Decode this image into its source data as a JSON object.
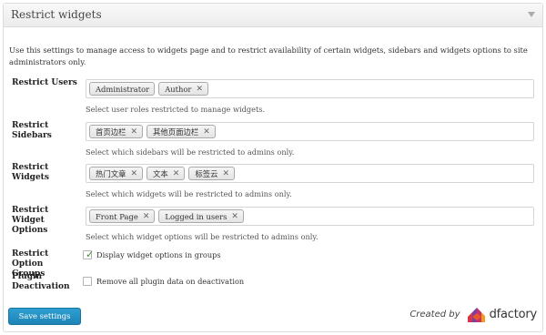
{
  "panel": {
    "title": "Restrict widgets"
  },
  "description": "Use this settings to manage access to widgets page and to restrict availability of certain widgets, sidebars and widgets options to site administrators only.",
  "rows": [
    {
      "label": "Restrict Users",
      "tags": [
        "Administrator",
        "Author"
      ],
      "help": "Select user roles restricted to manage widgets."
    },
    {
      "label": "Restrict Sidebars",
      "tags": [
        "首页边栏",
        "其他页面边栏"
      ],
      "help": "Select which sidebars will be restricted to admins only."
    },
    {
      "label": "Restrict Widgets",
      "tags": [
        "热门文章",
        "文本",
        "标签云"
      ],
      "help": "Select which widgets will be restricted to admins only."
    },
    {
      "label": "Restrict Widget Options",
      "tags": [
        "Front Page",
        "Logged in users"
      ],
      "help": "Select which widget options will be restricted to admins only."
    }
  ],
  "option_groups": {
    "label": "Restrict Option Groups",
    "checked": true,
    "text": "Display widget options in groups"
  },
  "plugin_deactivation": {
    "label": "Plugin Deactivation",
    "checked": false,
    "text": "Remove all plugin data on deactivation"
  },
  "save_label": "Save settings",
  "credit": {
    "text": "Created by",
    "brand": "dfactory"
  },
  "colors": {
    "primary_button": "#2a94c8",
    "logo_red": "#d8334a",
    "logo_purple": "#7b3fa0",
    "logo_orange": "#f39a1e"
  }
}
